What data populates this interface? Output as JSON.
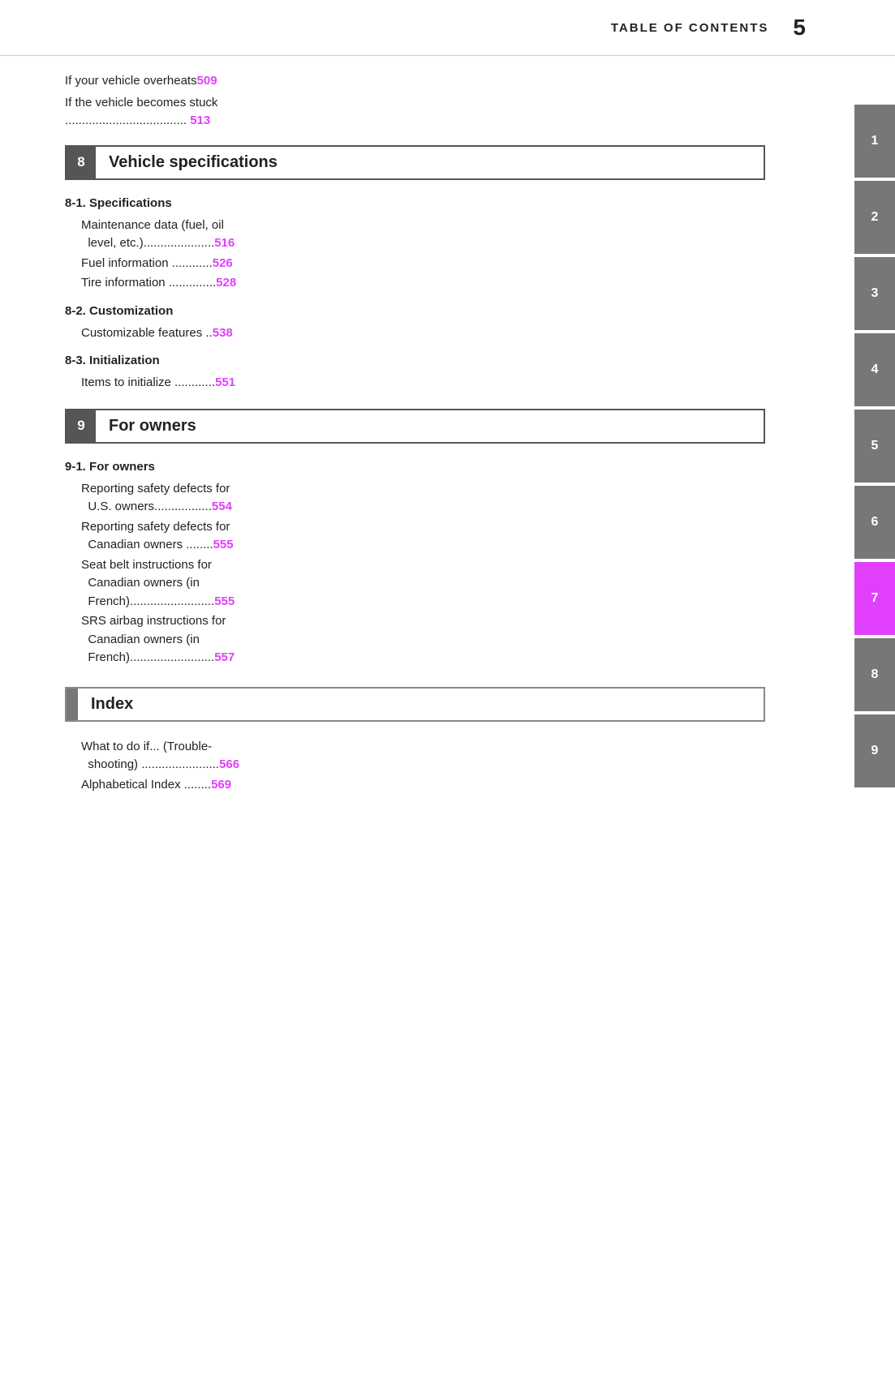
{
  "header": {
    "title": "TABLE OF CONTENTS",
    "page_number": "5"
  },
  "prev_section": {
    "entry1": {
      "text": "If your vehicle overheats",
      "page": "509"
    },
    "entry2": {
      "text": "If the vehicle becomes stuck",
      "dots": ".....................................",
      "page": "513"
    }
  },
  "sections": [
    {
      "id": "section-8",
      "num": "8",
      "title": "Vehicle specifications",
      "subsections": [
        {
          "id": "8-1",
          "label": "8-1.",
          "name": "Specifications",
          "entries": [
            {
              "text": "Maintenance data (fuel, oil level, etc.).....................",
              "page": "516"
            },
            {
              "text": "Fuel information ............",
              "page": "526"
            },
            {
              "text": "Tire information ..............",
              "page": "528"
            }
          ]
        },
        {
          "id": "8-2",
          "label": "8-2.",
          "name": "Customization",
          "entries": [
            {
              "text": "Customizable features ..",
              "page": "538"
            }
          ]
        },
        {
          "id": "8-3",
          "label": "8-3.",
          "name": "Initialization",
          "entries": [
            {
              "text": "Items to initialize ............",
              "page": "551"
            }
          ]
        }
      ]
    },
    {
      "id": "section-9",
      "num": "9",
      "title": "For owners",
      "subsections": [
        {
          "id": "9-1",
          "label": "9-1.",
          "name": "For owners",
          "entries": [
            {
              "text": "Reporting safety defects for U.S. owners.................",
              "page": "554"
            },
            {
              "text": "Reporting safety defects for Canadian owners ........",
              "page": "555"
            },
            {
              "text": "Seat belt instructions for Canadian owners (in French).........................",
              "page": "555"
            },
            {
              "text": "SRS airbag instructions for Canadian owners (in French).........................",
              "page": "557"
            }
          ]
        }
      ]
    }
  ],
  "index_section": {
    "title": "Index",
    "entries": [
      {
        "text": "What to do if... (Trouble-shooting) .....................",
        "page": "566"
      },
      {
        "text": "Alphabetical Index ........",
        "page": "569"
      }
    ]
  },
  "sidebar": {
    "tabs": [
      {
        "num": "1",
        "type": "gray"
      },
      {
        "num": "2",
        "type": "gray"
      },
      {
        "num": "3",
        "type": "gray"
      },
      {
        "num": "4",
        "type": "gray"
      },
      {
        "num": "5",
        "type": "gray"
      },
      {
        "num": "6",
        "type": "gray"
      },
      {
        "num": "7",
        "type": "pink"
      },
      {
        "num": "8",
        "type": "gray"
      },
      {
        "num": "9",
        "type": "gray"
      }
    ]
  },
  "colors": {
    "accent": "#e040fb",
    "gray": "#777",
    "dark": "#555",
    "text": "#222"
  }
}
